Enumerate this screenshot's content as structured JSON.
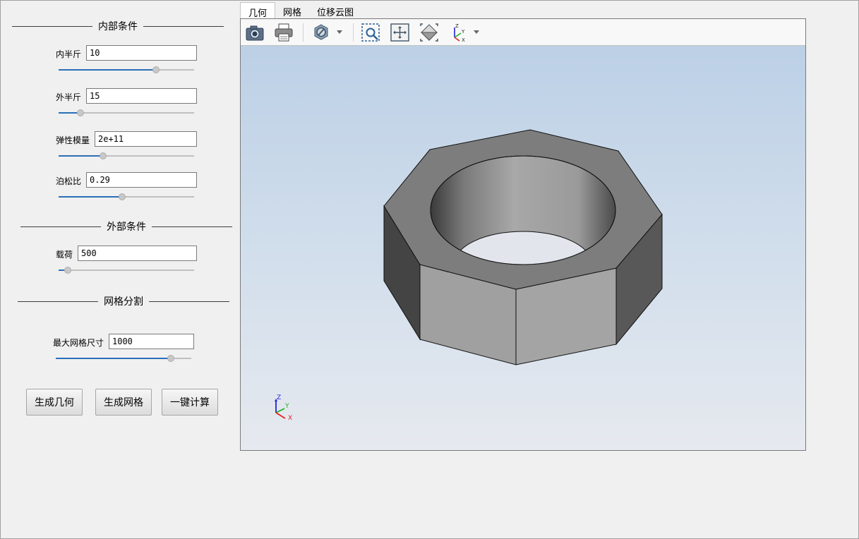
{
  "left_panel": {
    "internal_section": {
      "title": "内部条件",
      "fields": [
        {
          "label": "内半斤",
          "value": "10",
          "slider_fraction": 0.72
        },
        {
          "label": "外半斤",
          "value": "15",
          "slider_fraction": 0.16
        },
        {
          "label": "弹性模量",
          "value": "2e+11",
          "slider_fraction": 0.33
        },
        {
          "label": "泊松比",
          "value": "0.29",
          "slider_fraction": 0.47
        }
      ]
    },
    "external_section": {
      "title": "外部条件",
      "fields": [
        {
          "label": "载荷",
          "value": "500",
          "slider_fraction": 0.07
        }
      ]
    },
    "mesh_section": {
      "title": "网格分割",
      "fields": [
        {
          "label": "最大网格尺寸",
          "value": "1000",
          "slider_fraction": 0.85
        }
      ]
    },
    "buttons": {
      "generate_geometry": "生成几何",
      "generate_mesh": "生成网格",
      "one_click_compute": "一键计算"
    }
  },
  "tabs": [
    {
      "label": "几何",
      "active": true
    },
    {
      "label": "网格",
      "active": false
    },
    {
      "label": "位移云图",
      "active": false
    }
  ],
  "toolbar": {
    "icons": [
      "camera-icon",
      "print-icon",
      "display-mode-icon",
      "zoom-box-icon",
      "fit-all-icon",
      "view-iso-icon",
      "view-axes-icon"
    ]
  },
  "viewer": {
    "axis_labels": {
      "x": "X",
      "y": "Y",
      "z": "Z"
    },
    "colors": {
      "background_top": "#bcd0e6",
      "background_bottom": "#e6e9ef",
      "slider_fill": "#2a6fb8",
      "axis_x": "#e02020",
      "axis_y": "#20b020",
      "axis_z": "#2020e0"
    }
  }
}
